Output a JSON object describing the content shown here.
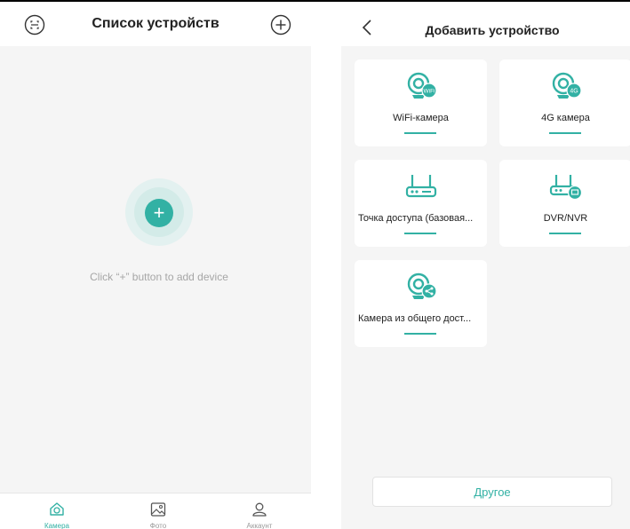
{
  "left_screen": {
    "title": "Список устройств",
    "empty_hint": "Click “+” button to add device",
    "add_symbol": "+",
    "icons": {
      "left": "scan-icon",
      "right": "add-circle-icon"
    },
    "tabs": [
      {
        "label": "Камера",
        "icon": "camera-home-icon",
        "active": true
      },
      {
        "label": "Фото",
        "icon": "photo-icon",
        "active": false
      },
      {
        "label": "Аккаунт",
        "icon": "account-icon",
        "active": false
      }
    ]
  },
  "right_screen": {
    "title": "Добавить устройство",
    "back_icon": "chevron-left-icon",
    "devices": [
      {
        "label": "WiFi-камера",
        "icon": "wifi-camera-icon",
        "badge": "WiFi"
      },
      {
        "label": "4G камера",
        "icon": "4g-camera-icon",
        "badge": "4G"
      },
      {
        "label": "Точка доступа (базовая...",
        "icon": "access-point-icon"
      },
      {
        "label": "DVR/NVR",
        "icon": "dvr-nvr-icon"
      },
      {
        "label": "Камера из общего дост...",
        "icon": "shared-camera-icon"
      }
    ],
    "other_label": "Другое"
  },
  "colors": {
    "accent": "#32b1a4",
    "background": "#f5f5f5",
    "card": "#ffffff",
    "hint_text": "#a6a6a6"
  }
}
